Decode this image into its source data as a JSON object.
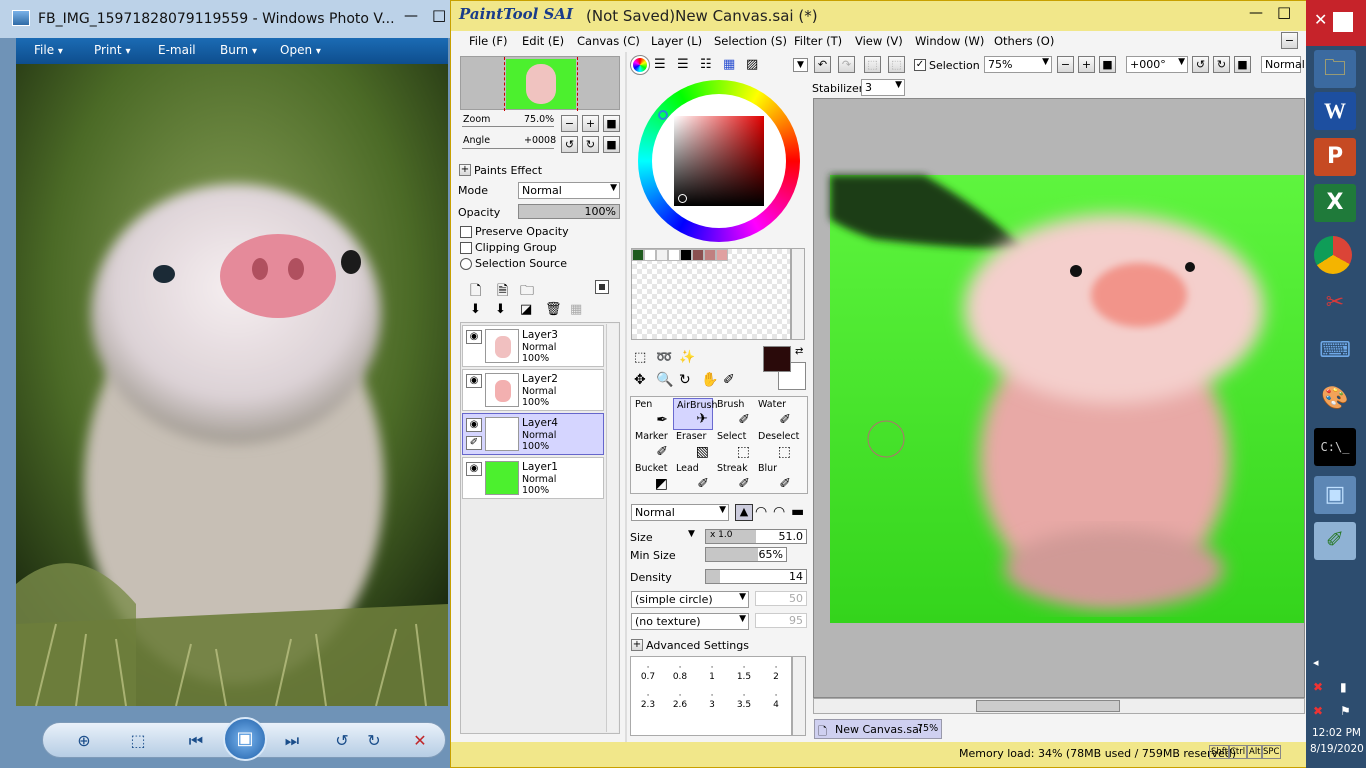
{
  "photo_viewer": {
    "title": "FB_IMG_15971828079119559 - Windows Photo V...",
    "menu": [
      {
        "label": "File",
        "arrow": "▾"
      },
      {
        "label": "Print",
        "arrow": "▾"
      },
      {
        "label": "E-mail"
      },
      {
        "label": "Burn",
        "arrow": "▾"
      },
      {
        "label": "Open",
        "arrow": "▾"
      }
    ],
    "win_minimize": "—",
    "win_maximize": "□"
  },
  "sai": {
    "app_name": "PaintTool SAI",
    "title": "(Not Saved)New Canvas.sai (*)",
    "menu": [
      "File (F)",
      "Edit (E)",
      "Canvas (C)",
      "Layer (L)",
      "Selection (S)",
      "Filter (T)",
      "View (V)",
      "Window (W)",
      "Others (O)"
    ],
    "navigator": {
      "zoom_label": "Zoom",
      "zoom_value": "75.0%",
      "angle_label": "Angle",
      "angle_value": "+0008"
    },
    "paints_effect": "Paints Effect",
    "mode_label": "Mode",
    "mode_value": "Normal",
    "opacity_label": "Opacity",
    "opacity_value": "100%",
    "opacity_fraction": 1.0,
    "preserve_opacity": "Preserve Opacity",
    "clipping_group": "Clipping Group",
    "selection_source": "Selection Source",
    "layers": [
      {
        "name": "Layer3",
        "mode": "Normal",
        "opacity": "100%",
        "selected": false,
        "thumb": "pig"
      },
      {
        "name": "Layer2",
        "mode": "Normal",
        "opacity": "100%",
        "selected": false,
        "thumb": "pink"
      },
      {
        "name": "Layer4",
        "mode": "Normal",
        "opacity": "100%",
        "selected": true,
        "thumb": "blank"
      },
      {
        "name": "Layer1",
        "mode": "Normal",
        "opacity": "100%",
        "selected": false,
        "thumb": "green"
      }
    ],
    "swatches": [
      "#1e5a1e",
      "#ffffff",
      "#f2f2f2",
      "#ffffff",
      "#000000",
      "#8a5050",
      "#c08080",
      "#e0a0a0"
    ],
    "tools": [
      {
        "name": "Pen",
        "icon": "✒"
      },
      {
        "name": "AirBrush",
        "icon": "✈",
        "selected": true
      },
      {
        "name": "Brush",
        "icon": "✐"
      },
      {
        "name": "Water",
        "icon": "✐"
      },
      {
        "name": "Marker",
        "icon": "✐"
      },
      {
        "name": "Eraser",
        "icon": "▧"
      },
      {
        "name": "Select",
        "icon": "⬚"
      },
      {
        "name": "Deselect",
        "icon": "⬚"
      },
      {
        "name": "Bucket",
        "icon": "◩"
      },
      {
        "name": "Lead",
        "icon": "✐"
      },
      {
        "name": "Streak",
        "icon": "✐"
      },
      {
        "name": "Blur",
        "icon": "✐"
      }
    ],
    "brush_mode": "Normal",
    "size_label": "Size",
    "size_mult": "x 1.0",
    "size_value": "51.0",
    "min_size_label": "Min Size",
    "min_size_value": "65%",
    "min_size_fraction": 0.65,
    "density_label": "Density",
    "density_value": "14",
    "density_fraction": 0.14,
    "shape": "(simple circle)",
    "shape_value": "50",
    "texture": "(no texture)",
    "texture_value": "95",
    "advanced_settings": "Advanced Settings",
    "brush_sizes_row1": [
      "0.7",
      "0.8",
      "1",
      "1.5",
      "2"
    ],
    "brush_sizes_row2": [
      "2.3",
      "2.6",
      "3",
      "3.5",
      "4"
    ],
    "toolbar": {
      "selection_label": "Selection",
      "zoom_value": "75%",
      "angle_value": "+000°",
      "blend_mode": "Normal",
      "stabilizer_label": "Stabilizer",
      "stabilizer_value": "3"
    },
    "doc_tab": {
      "name": "New Canvas.sai",
      "zoom": "75%"
    },
    "status": "Memory load: 34% (78MB used / 759MB reserved)",
    "keys": [
      "Shft",
      "Ctrl",
      "Alt",
      "SPC"
    ]
  },
  "taskbar": {
    "time": "12:02 PM",
    "date": "8/19/2020",
    "icons": [
      "word-icon",
      "powerpoint-icon",
      "excel-icon",
      "chrome-icon",
      "paint-tools-icon",
      "keyboard-icon",
      "paint-palette-icon",
      "cmd-icon",
      "photo-viewer-icon",
      "painttool-sai-icon"
    ]
  },
  "colors": {
    "accent_title": "#f1e78a",
    "canvas_green": "#4cf02e",
    "selection": "#d5d5ff"
  }
}
